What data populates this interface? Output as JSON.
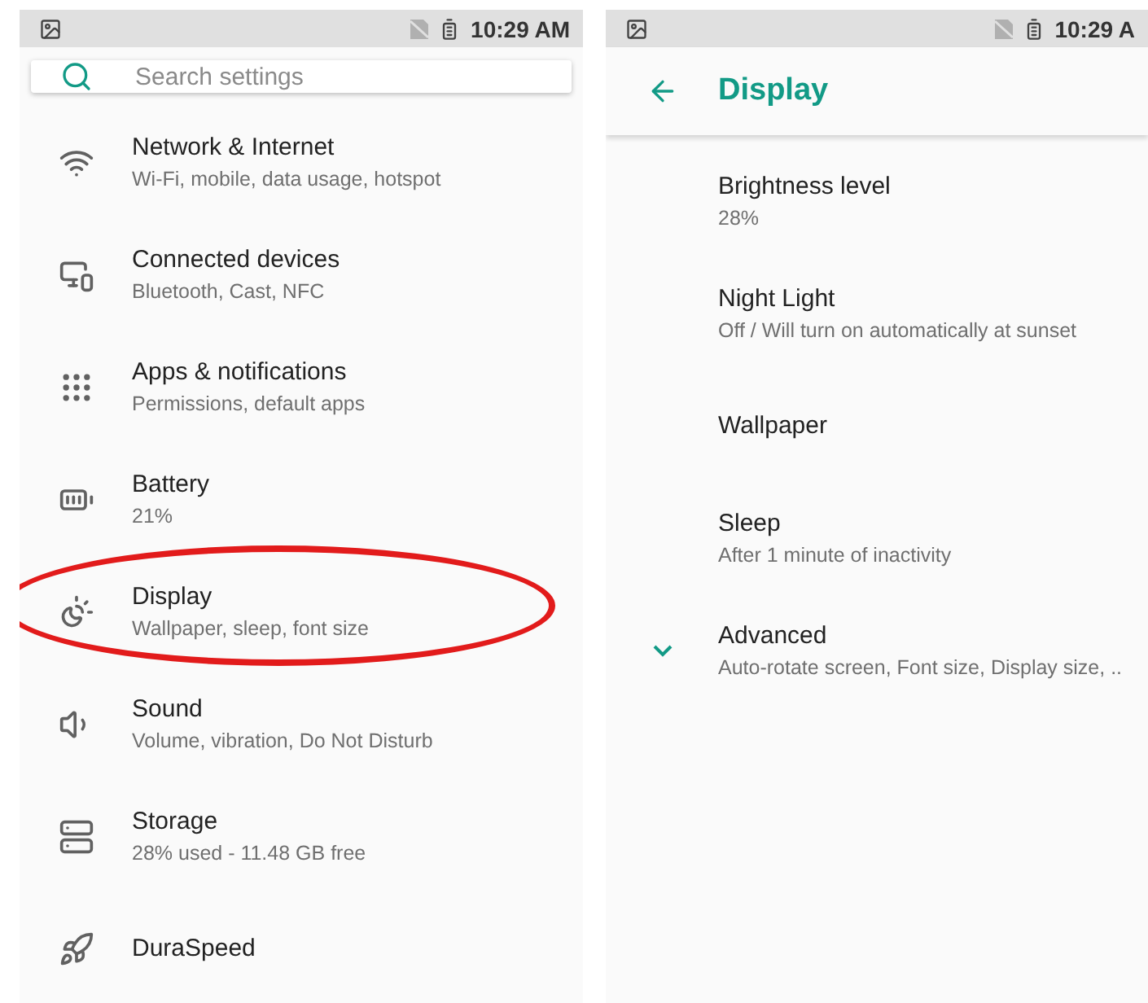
{
  "left_screen": {
    "status_bar": {
      "time": "10:29 AM"
    },
    "search": {
      "placeholder": "Search settings"
    },
    "items": [
      {
        "title": "Network & Internet",
        "subtitle": "Wi-Fi, mobile, data usage, hotspot",
        "circled": false
      },
      {
        "title": "Connected devices",
        "subtitle": "Bluetooth, Cast, NFC",
        "circled": false
      },
      {
        "title": "Apps & notifications",
        "subtitle": "Permissions, default apps",
        "circled": false
      },
      {
        "title": "Battery",
        "subtitle": "21%",
        "circled": false
      },
      {
        "title": "Display",
        "subtitle": "Wallpaper, sleep, font size",
        "circled": true
      },
      {
        "title": "Sound",
        "subtitle": "Volume, vibration, Do Not Disturb",
        "circled": false
      },
      {
        "title": "Storage",
        "subtitle": "28% used - 11.48 GB free",
        "circled": false
      },
      {
        "title": "DuraSpeed",
        "circled": false
      }
    ]
  },
  "right_screen": {
    "status_bar": {
      "time": "10:29 A"
    },
    "title": "Display",
    "items": [
      {
        "kind": "plain",
        "title": "Brightness level",
        "subtitle": "28%"
      },
      {
        "kind": "plain",
        "title": "Night Light",
        "subtitle": "Off / Will turn on automatically at sunset"
      },
      {
        "kind": "plain",
        "title": "Wallpaper"
      },
      {
        "kind": "plain",
        "title": "Sleep",
        "subtitle": "After 1 minute of inactivity"
      },
      {
        "kind": "expander",
        "title": "Advanced",
        "subtitle": "Auto-rotate screen, Font size, Display size, .."
      }
    ]
  }
}
